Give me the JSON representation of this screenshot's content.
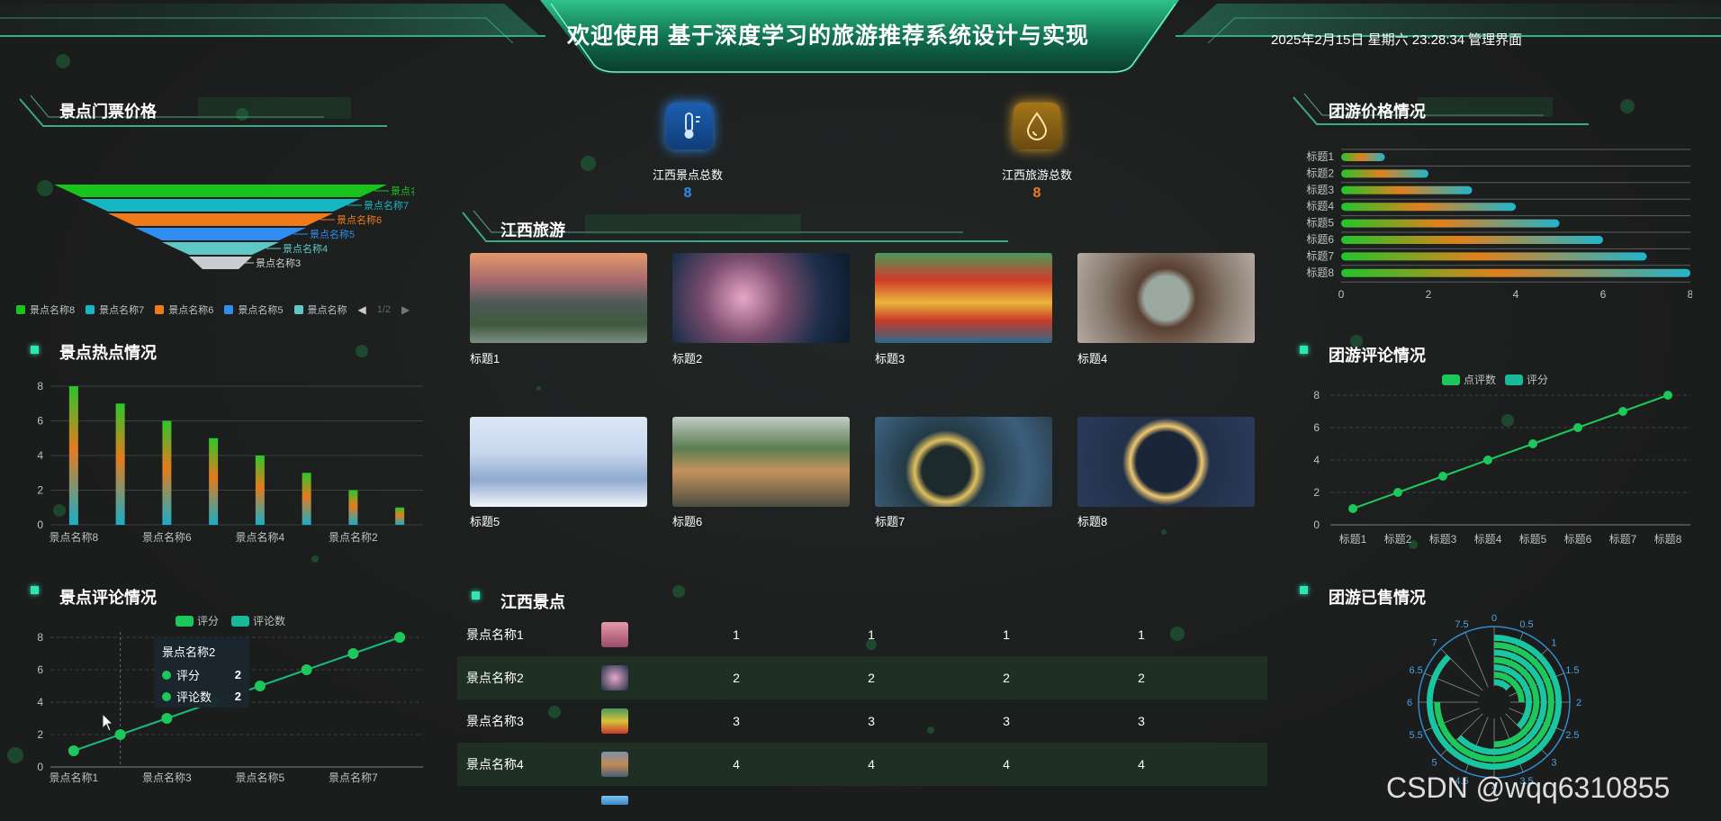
{
  "header": {
    "title": "欢迎使用 基于深度学习的旅游推荐系统设计与实现",
    "datetime": "2025年2月15日 星期六 23:28:34",
    "admin_link": "管理界面"
  },
  "panels": {
    "ticket_price": "景点门票价格",
    "hotspot": "景点热点情况",
    "spot_reviews": "景点评论情况",
    "jiangxi_travel": "江西旅游",
    "jiangxi_spots": "江西景点",
    "group_price": "团游价格情况",
    "group_reviews": "团游评论情况",
    "group_sold": "团游已售情况"
  },
  "stats": [
    {
      "label": "江西景点总数",
      "value": "8",
      "color": "#2f8cf0"
    },
    {
      "label": "江西旅游总数",
      "value": "8",
      "color": "#f07a24"
    }
  ],
  "funnel": {
    "labels": [
      "景点名称8",
      "景点名称7",
      "景点名称6",
      "景点名称5",
      "景点名称4",
      "景点名称3"
    ],
    "colors": [
      "#18c41c",
      "#16b6c2",
      "#f07a1a",
      "#2f8cf0",
      "#5ec8c6",
      "#c9cdd2"
    ],
    "legend": [
      "景点名称8",
      "景点名称7",
      "景点名称6",
      "景点名称5",
      "景点名称"
    ],
    "pager": "1/2"
  },
  "chart_data": [
    {
      "type": "bar",
      "title": "景点热点情况",
      "categories": [
        "景点名称8",
        "景点名称7",
        "景点名称6",
        "景点名称5",
        "景点名称4",
        "景点名称3",
        "景点名称2",
        "景点名称1"
      ],
      "tick_labels": [
        "景点名称8",
        "景点名称6",
        "景点名称4",
        "景点名称2"
      ],
      "values": [
        8,
        7,
        6,
        5,
        4,
        3,
        2,
        1
      ],
      "y_ticks": [
        "0",
        "2",
        "4",
        "6",
        "8"
      ],
      "ylim": [
        0,
        8
      ]
    },
    {
      "type": "line",
      "title": "景点评论情况",
      "categories": [
        "景点名称1",
        "景点名称2",
        "景点名称3",
        "景点名称4",
        "景点名称5",
        "景点名称6",
        "景点名称7",
        "景点名称8"
      ],
      "tick_labels": [
        "景点名称1",
        "景点名称3",
        "景点名称5",
        "景点名称7"
      ],
      "series": [
        {
          "name": "评分",
          "values": [
            1,
            2,
            3,
            4,
            5,
            6,
            7,
            8
          ]
        },
        {
          "name": "评论数",
          "values": [
            1,
            2,
            3,
            4,
            5,
            6,
            7,
            8
          ]
        }
      ],
      "y_ticks": [
        "0",
        "2",
        "4",
        "6",
        "8"
      ],
      "ylim": [
        0,
        8
      ],
      "tooltip": {
        "title": "景点名称2",
        "rows": [
          {
            "name": "评分",
            "value": "2"
          },
          {
            "name": "评论数",
            "value": "2"
          }
        ]
      }
    },
    {
      "type": "bar",
      "title": "团游价格情况",
      "orientation": "horizontal",
      "categories": [
        "标题1",
        "标题2",
        "标题3",
        "标题4",
        "标题5",
        "标题6",
        "标题7",
        "标题8"
      ],
      "values": [
        1,
        2,
        3,
        4,
        5,
        6,
        7,
        8
      ],
      "x_ticks": [
        "0",
        "2",
        "4",
        "6",
        "8"
      ],
      "xlim": [
        0,
        8
      ]
    },
    {
      "type": "line",
      "title": "团游评论情况",
      "categories": [
        "标题1",
        "标题2",
        "标题3",
        "标题4",
        "标题5",
        "标题6",
        "标题7",
        "标题8"
      ],
      "series": [
        {
          "name": "点评数",
          "values": [
            1,
            2,
            3,
            4,
            5,
            6,
            7,
            8
          ]
        },
        {
          "name": "评分",
          "values": [
            1,
            2,
            3,
            4,
            5,
            6,
            7,
            8
          ]
        }
      ],
      "y_ticks": [
        "0",
        "2",
        "4",
        "6",
        "8"
      ],
      "ylim": [
        0,
        8
      ]
    },
    {
      "type": "bar",
      "title": "团游已售情况",
      "polar": true,
      "categories": [
        "标题8",
        "标题7",
        "标题6",
        "标题5",
        "标题4",
        "标题3",
        "标题2",
        "标题1"
      ],
      "values": [
        1,
        2,
        3,
        4,
        5,
        6,
        7,
        8
      ],
      "angle_ticks": [
        "0",
        "0.5",
        "1",
        "1.5",
        "2",
        "2.5",
        "3",
        "3.5",
        "4",
        "4.5",
        "5",
        "5.5",
        "6",
        "6.5",
        "7",
        "7.5"
      ],
      "angle_max": 8
    }
  ],
  "gallery": [
    {
      "caption": "标题1"
    },
    {
      "caption": "标题2"
    },
    {
      "caption": "标题3"
    },
    {
      "caption": "标题4"
    },
    {
      "caption": "标题5"
    },
    {
      "caption": "标题6"
    },
    {
      "caption": "标题7"
    },
    {
      "caption": "标题8"
    }
  ],
  "spot_table": [
    {
      "name": "景点名称1",
      "c1": "1",
      "c2": "1",
      "c3": "1",
      "c4": "1"
    },
    {
      "name": "景点名称2",
      "c1": "2",
      "c2": "2",
      "c3": "2",
      "c4": "2"
    },
    {
      "name": "景点名称3",
      "c1": "3",
      "c2": "3",
      "c3": "3",
      "c4": "3"
    },
    {
      "name": "景点名称4",
      "c1": "4",
      "c2": "4",
      "c3": "4",
      "c4": "4"
    }
  ],
  "watermark": "CSDN @wqq6310855"
}
